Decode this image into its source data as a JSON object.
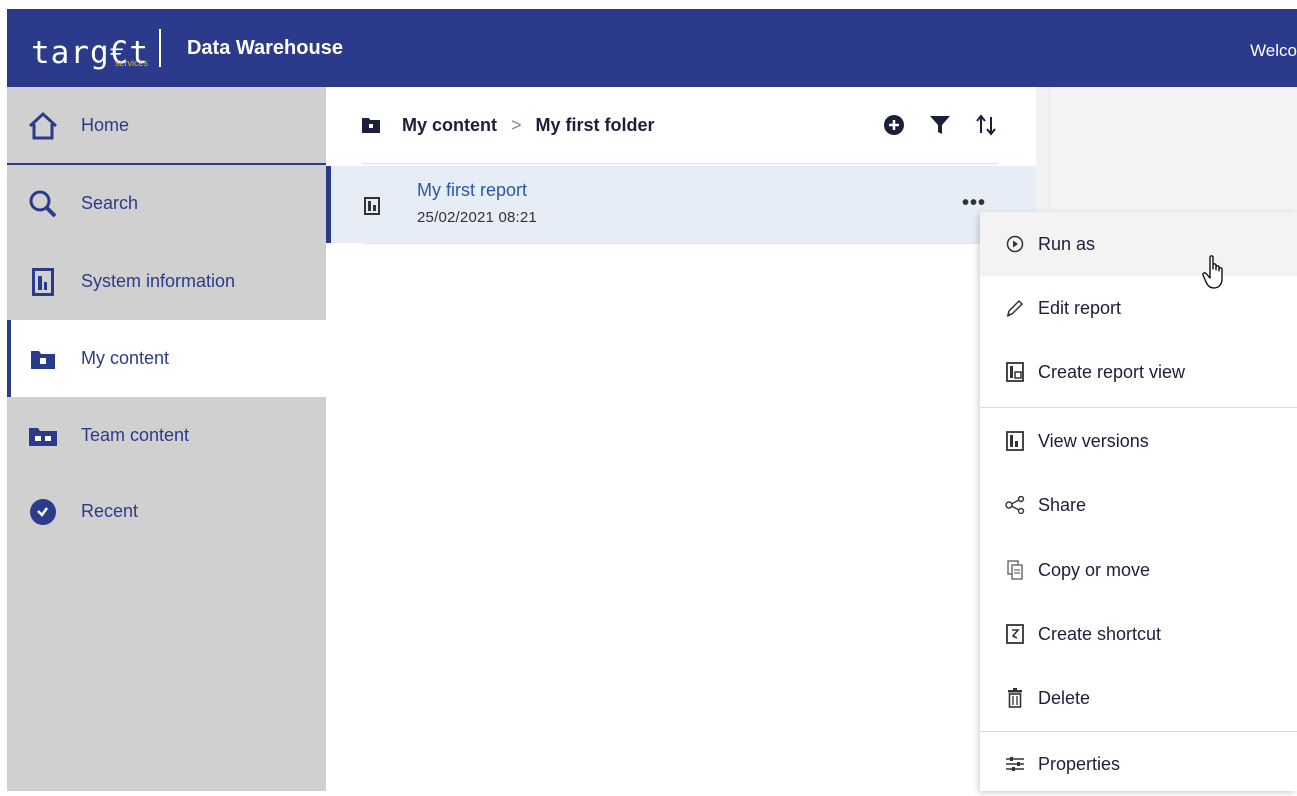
{
  "header": {
    "logo_text": "targ€t",
    "logo_sub": "services",
    "app_title": "Data Warehouse",
    "welcome": "Welco"
  },
  "sidebar": {
    "items": [
      {
        "label": "Home",
        "icon": "home-icon"
      },
      {
        "label": "Search",
        "icon": "search-icon"
      },
      {
        "label": "System information",
        "icon": "system-info-icon"
      },
      {
        "label": "My content",
        "icon": "my-content-folder-icon",
        "active": true
      },
      {
        "label": "Team content",
        "icon": "team-content-folder-icon"
      },
      {
        "label": "Recent",
        "icon": "recent-clock-icon"
      }
    ]
  },
  "content": {
    "breadcrumb": {
      "root": "My content",
      "separator": ">",
      "current": "My first folder"
    },
    "toolbar": {
      "add": "add-icon",
      "filter": "filter-icon",
      "sort": "sort-icon"
    },
    "rows": [
      {
        "title": "My first report",
        "timestamp": "25/02/2021 08:21",
        "more": "•••"
      }
    ]
  },
  "menu": {
    "items": [
      {
        "label": "Run as",
        "icon": "run-play-icon"
      },
      {
        "label": "Edit report",
        "icon": "pencil-icon"
      },
      {
        "label": "Create report view",
        "icon": "report-view-icon"
      },
      {
        "label": "View versions",
        "icon": "versions-icon"
      },
      {
        "label": "Share",
        "icon": "share-icon"
      },
      {
        "label": "Copy or move",
        "icon": "copy-icon"
      },
      {
        "label": "Create shortcut",
        "icon": "shortcut-icon"
      },
      {
        "label": "Delete",
        "icon": "trash-icon"
      },
      {
        "label": "Properties",
        "icon": "properties-sliders-icon"
      }
    ]
  },
  "colors": {
    "brand": "#2b3a8a",
    "accent_gold": "#e8b82c",
    "link": "#2b57a8",
    "sidebar_bg": "#d0d0d0",
    "selected_row": "#e6edf6"
  }
}
